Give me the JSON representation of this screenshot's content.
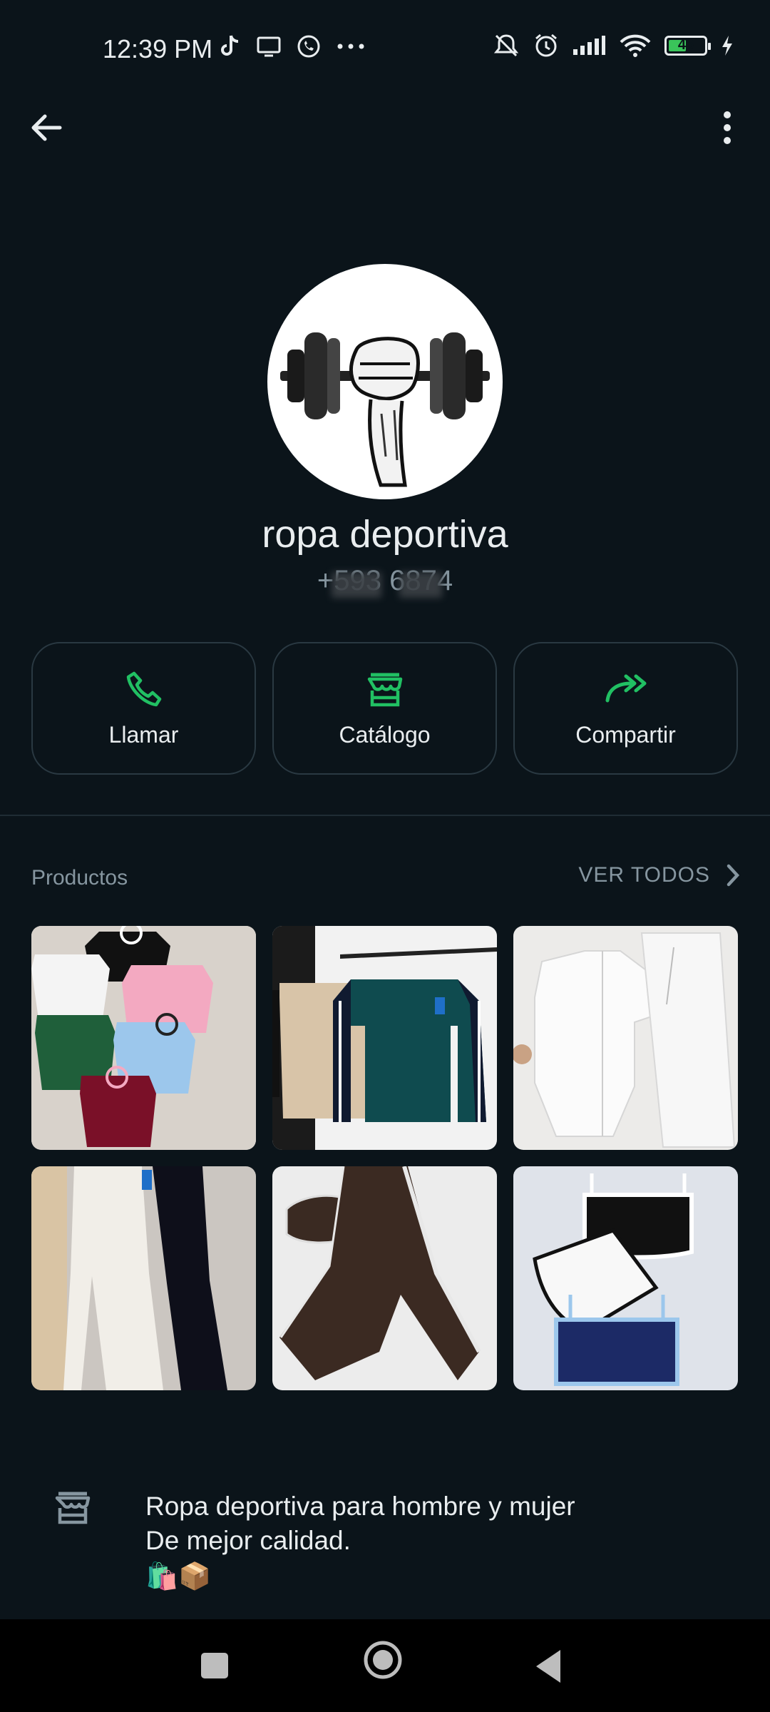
{
  "status_bar": {
    "time": "12:39 PM",
    "battery_level": "45",
    "icons": [
      "tiktok-icon",
      "cast-icon",
      "whatsapp-icon",
      "more-dots-icon",
      "mute-icon",
      "alarm-icon",
      "signal-icon",
      "wifi-icon",
      "battery-icon",
      "charging-icon"
    ]
  },
  "header": {
    "back_icon": "arrow-left-icon",
    "menu_icon": "more-vert-icon"
  },
  "profile": {
    "name": "ropa deportiva",
    "phone": "+593          6874"
  },
  "actions": [
    {
      "label": "Llamar",
      "icon": "phone-icon"
    },
    {
      "label": "Catálogo",
      "icon": "store-icon"
    },
    {
      "label": "Compartir",
      "icon": "forward-icon"
    }
  ],
  "products": {
    "title": "Productos",
    "see_all": "VER TODOS",
    "items": [
      {
        "description": "colored t-shirts"
      },
      {
        "description": "sweatshirts on hangers"
      },
      {
        "description": "white zip top"
      },
      {
        "description": "flared pants"
      },
      {
        "description": "brown track pants"
      },
      {
        "description": "sports bras"
      }
    ]
  },
  "description": {
    "line1": "Ropa deportiva para hombre y mujer",
    "line2": "De mejor calidad.",
    "emojis": "🛍️📦"
  },
  "colors": {
    "background": "#0b141a",
    "accent": "#21c063",
    "secondary_text": "#8696a0",
    "border": "#2a3942"
  }
}
